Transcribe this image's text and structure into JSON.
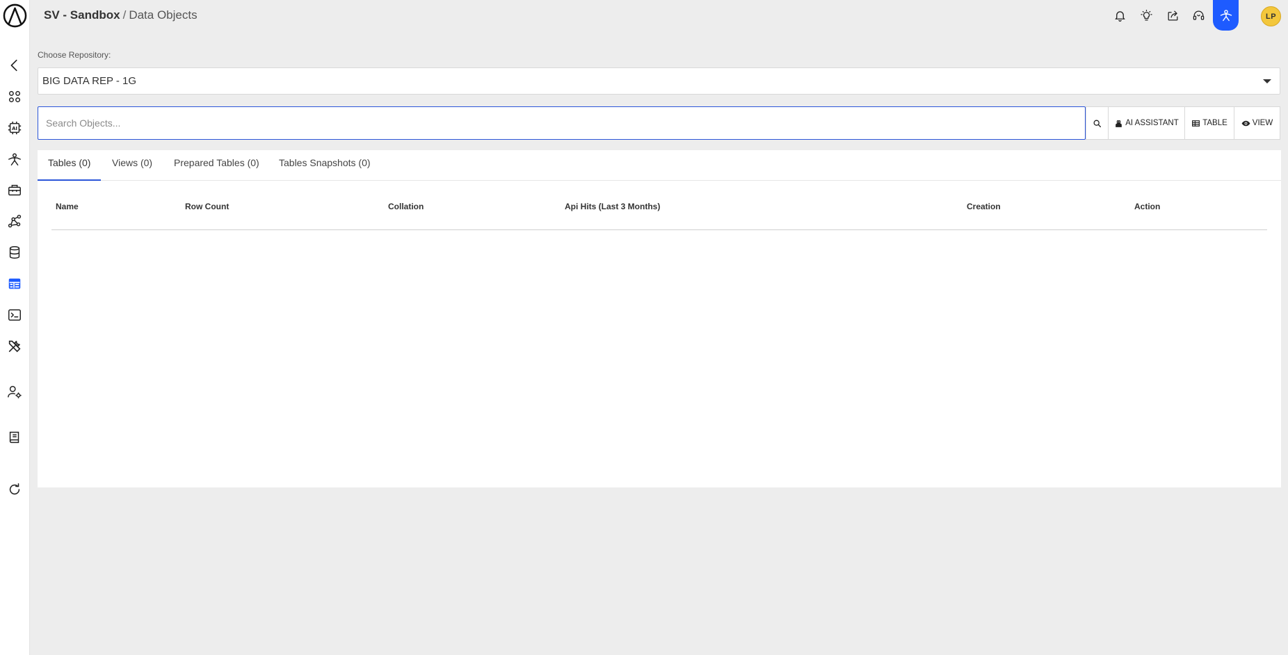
{
  "header": {
    "project": "SV - Sandbox",
    "separator": "/",
    "page": "Data Objects"
  },
  "sidebar": {
    "items": [
      {
        "name": "back-icon"
      },
      {
        "name": "apps-icon"
      },
      {
        "name": "ai-chip-icon"
      },
      {
        "name": "person-pose-icon"
      },
      {
        "name": "toolbox-icon"
      },
      {
        "name": "pipeline-icon"
      },
      {
        "name": "database-icon"
      },
      {
        "name": "table-icon",
        "active": true
      },
      {
        "name": "terminal-icon"
      },
      {
        "name": "tools-icon"
      },
      {
        "name": "user-settings-icon"
      },
      {
        "name": "book-icon"
      },
      {
        "name": "refresh-icon"
      }
    ],
    "active_color": "#1e5bff"
  },
  "topbar": {
    "icons": [
      "bell-icon",
      "lightbulb-icon",
      "share-icon",
      "headset-icon",
      "user-pose-icon"
    ],
    "avatar_initials": "LP"
  },
  "repository": {
    "label": "Choose Repository:",
    "selected": "BIG DATA REP - 1G"
  },
  "search": {
    "placeholder": "Search Objects...",
    "value": ""
  },
  "actions": {
    "ai_assistant": "AI ASSISTANT",
    "table": "TABLE",
    "view": "VIEW"
  },
  "tabs": [
    {
      "label": "Tables (0)",
      "active": true
    },
    {
      "label": "Views (0)"
    },
    {
      "label": "Prepared Tables (0)"
    },
    {
      "label": "Tables Snapshots (0)"
    }
  ],
  "table": {
    "columns": [
      "Name",
      "Row Count",
      "Collation",
      "Api Hits (Last 3 Months)",
      "Creation",
      "Action"
    ],
    "rows": []
  },
  "colors": {
    "accent": "#2b55d9",
    "active_icon_bg": "#1e5bff",
    "avatar": "#f3c73c",
    "background": "#ededed"
  }
}
